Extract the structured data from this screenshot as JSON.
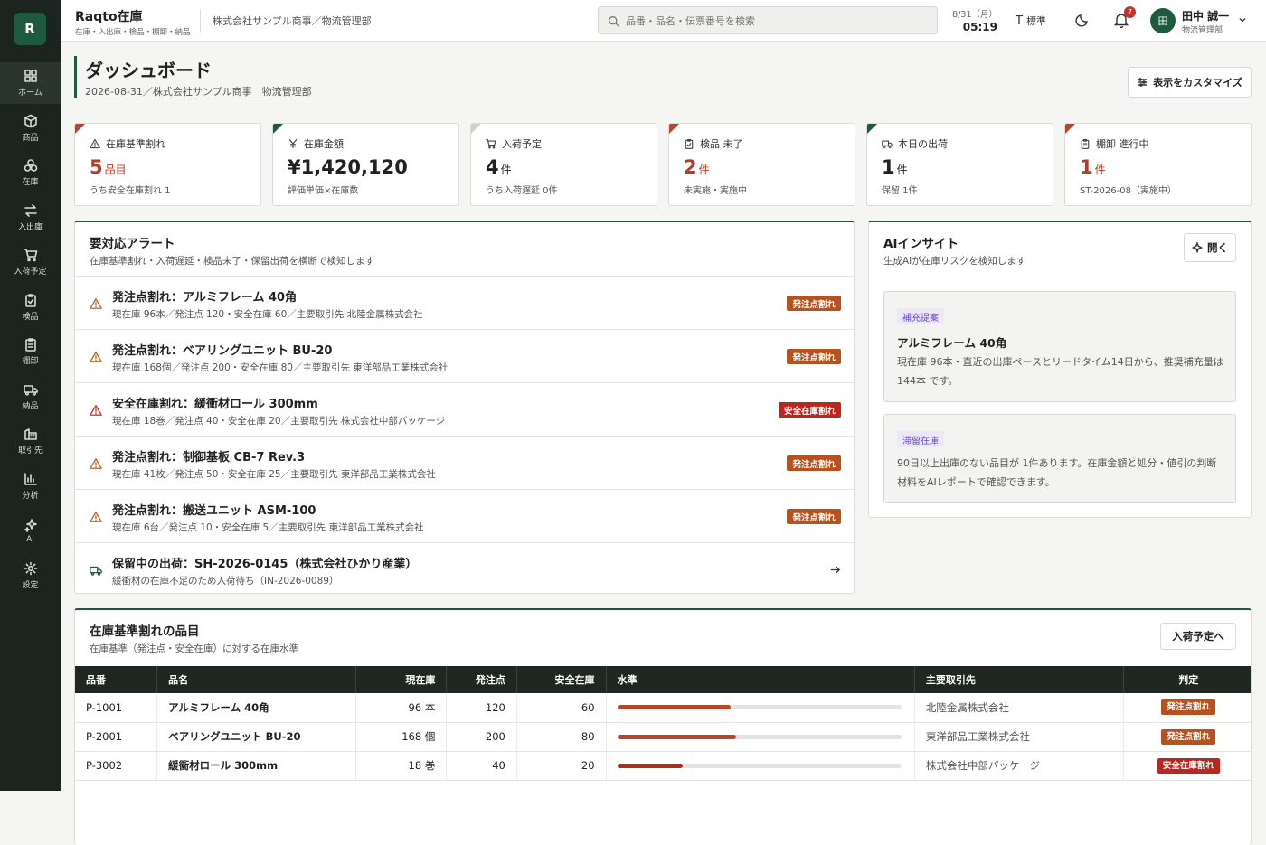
{
  "app": {
    "logo_letter": "R",
    "title": "Raqto在庫",
    "subtitle": "在庫・入出庫・検品・棚卸・納品",
    "org": "株式会社サンプル商事／物流管理部"
  },
  "search": {
    "placeholder": "品番・品名・伝票番号を検索"
  },
  "datetime": {
    "date": "8/31（月）",
    "time": "05:19"
  },
  "font_size_label": "標準",
  "notifications": {
    "count": "7"
  },
  "user": {
    "initial": "田",
    "name": "田中 誠一",
    "role": "物流管理部"
  },
  "sidebar": {
    "items": [
      {
        "label": "ホーム",
        "icon": "home-grid-icon",
        "active": true
      },
      {
        "label": "商品",
        "icon": "box-icon"
      },
      {
        "label": "在庫",
        "icon": "stock-boxes-icon"
      },
      {
        "label": "入出庫",
        "icon": "transfer-arrows-icon"
      },
      {
        "label": "入荷予定",
        "icon": "cart-icon"
      },
      {
        "label": "検品",
        "icon": "clipboard-check-icon"
      },
      {
        "label": "棚卸",
        "icon": "clipboard-list-icon"
      },
      {
        "label": "納品",
        "icon": "truck-icon"
      },
      {
        "label": "取引先",
        "icon": "building-icon"
      },
      {
        "label": "分析",
        "icon": "bar-chart-icon"
      },
      {
        "label": "AI",
        "icon": "sparkle-icon"
      },
      {
        "label": "設定",
        "icon": "gear-icon"
      }
    ]
  },
  "page": {
    "title": "ダッシュボード",
    "subtitle": "2026-08-31／株式会社サンプル商事　物流管理部",
    "customize_label": "表示をカスタマイズ"
  },
  "kpis": [
    {
      "label": "在庫基準割れ",
      "value": "5",
      "unit": "品目",
      "note": "うち安全在庫割れ 1",
      "icon": "warning-icon",
      "red": true,
      "corner": "#b8452a"
    },
    {
      "label": "在庫金額",
      "value": "¥1,420,120",
      "unit": "",
      "note": "評価単価×在庫数",
      "icon": "yen-icon",
      "red": false,
      "corner": "#1d5a3e"
    },
    {
      "label": "入荷予定",
      "value": "4",
      "unit": "件",
      "note": "うち入荷遅延 0件",
      "icon": "cart-icon",
      "red": false,
      "corner": "#c7d3cc"
    },
    {
      "label": "検品 未了",
      "value": "2",
      "unit": "件",
      "note": "未実施・実施中",
      "icon": "clipboard-check-icon",
      "red": true,
      "corner": "#b8452a"
    },
    {
      "label": "本日の出荷",
      "value": "1",
      "unit": "件",
      "note": "保留 1件",
      "icon": "truck-icon",
      "red": false,
      "corner": "#1d5a3e"
    },
    {
      "label": "棚卸 進行中",
      "value": "1",
      "unit": "件",
      "note": "ST-2026-08（実施中）",
      "icon": "clipboard-list-icon",
      "red": true,
      "corner": "#b8452a"
    }
  ],
  "alerts": {
    "title": "要対応アラート",
    "subtitle": "在庫基準割れ・入荷遅延・検品未了・保留出荷を横断で検知します",
    "items": [
      {
        "title": "発注点割れ：アルミフレーム 40角",
        "detail": "現在庫 96本／発注点 120・安全在庫 60／主要取引先 北陸金属株式会社",
        "tag": "発注点割れ",
        "kind": "o",
        "icon": "warning-icon",
        "color": "#c0642a"
      },
      {
        "title": "発注点割れ：ベアリングユニット BU-20",
        "detail": "現在庫 168個／発注点 200・安全在庫 80／主要取引先 東洋部品工業株式会社",
        "tag": "発注点割れ",
        "kind": "o",
        "icon": "warning-icon",
        "color": "#c0642a"
      },
      {
        "title": "安全在庫割れ：緩衝材ロール 300mm",
        "detail": "現在庫 18巻／発注点 40・安全在庫 20／主要取引先 株式会社中部パッケージ",
        "tag": "安全在庫割れ",
        "kind": "r",
        "icon": "warning-icon",
        "color": "#c0322a"
      },
      {
        "title": "発注点割れ：制御基板 CB-7 Rev.3",
        "detail": "現在庫 41枚／発注点 50・安全在庫 25／主要取引先 東洋部品工業株式会社",
        "tag": "発注点割れ",
        "kind": "o",
        "icon": "warning-icon",
        "color": "#c0642a"
      },
      {
        "title": "発注点割れ：搬送ユニット ASM-100",
        "detail": "現在庫 6台／発注点 10・安全在庫 5／主要取引先 東洋部品工業株式会社",
        "tag": "発注点割れ",
        "kind": "o",
        "icon": "warning-icon",
        "color": "#c0642a"
      },
      {
        "title": "保留中の出荷：SH-2026-0145（株式会社ひかり産業）",
        "detail": "緩衝材の在庫不足のため入荷待ち（IN-2026-0089）",
        "tag": "",
        "kind": "",
        "icon": "truck-icon",
        "color": "#1d5a3e"
      }
    ]
  },
  "ai": {
    "title": "AIインサイト",
    "subtitle": "生成AIが在庫リスクを検知します",
    "open_label": "開く",
    "cards": [
      {
        "tag": "補充提案",
        "title": "アルミフレーム 40角",
        "body": "現在庫 96本・直近の出庫ペースとリードタイム14日から、推奨補充量は144本 です。"
      },
      {
        "tag": "滞留在庫",
        "title": "",
        "body": "90日以上出庫のない品目が 1件あります。在庫金額と処分・値引の判断材料をAIレポートで確認できます。"
      }
    ]
  },
  "shortage": {
    "title": "在庫基準割れの品目",
    "subtitle": "在庫基準（発注点・安全在庫）に対する在庫水準",
    "button_label": "入荷予定へ",
    "columns": [
      "品番",
      "品名",
      "現在庫",
      "発注点",
      "安全在庫",
      "水準",
      "主要取引先",
      "判定"
    ],
    "rows": [
      {
        "code": "P-1001",
        "name": "アルミフレーム 40角",
        "stock": "96 本",
        "reorder": "120",
        "safety": "60",
        "level": 0.4,
        "supplier": "北陸金属株式会社",
        "status": "発注点割れ",
        "kind": "o"
      },
      {
        "code": "P-2001",
        "name": "ベアリングユニット BU-20",
        "stock": "168 個",
        "reorder": "200",
        "safety": "80",
        "level": 0.42,
        "supplier": "東洋部品工業株式会社",
        "status": "発注点割れ",
        "kind": "o"
      },
      {
        "code": "P-3002",
        "name": "緩衝材ロール 300mm",
        "stock": "18 巻",
        "reorder": "40",
        "safety": "20",
        "level": 0.23,
        "supplier": "株式会社中部パッケージ",
        "status": "安全在庫割れ",
        "kind": "r"
      }
    ]
  },
  "colors": {
    "brand": "#1d5a3e",
    "sidebar": "#1c2420",
    "orange": "#b4531f",
    "red": "#b8281f",
    "level_orange": "#b8452a",
    "level_red": "#b8281f"
  }
}
